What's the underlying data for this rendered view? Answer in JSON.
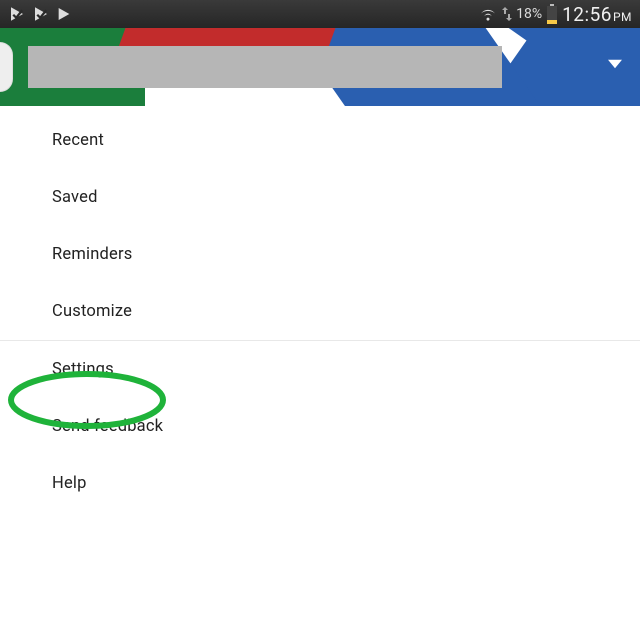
{
  "statusbar": {
    "battery_pct": "18%",
    "time": "12:56",
    "ampm": "PM"
  },
  "menu": {
    "items": [
      {
        "label": "Recent"
      },
      {
        "label": "Saved"
      },
      {
        "label": "Reminders"
      },
      {
        "label": "Customize"
      },
      {
        "label": "Settings"
      },
      {
        "label": "Send feedback"
      },
      {
        "label": "Help"
      }
    ],
    "divider_after_index": 3,
    "highlighted_index": 4
  },
  "colors": {
    "highlight": "#1fb33a"
  }
}
